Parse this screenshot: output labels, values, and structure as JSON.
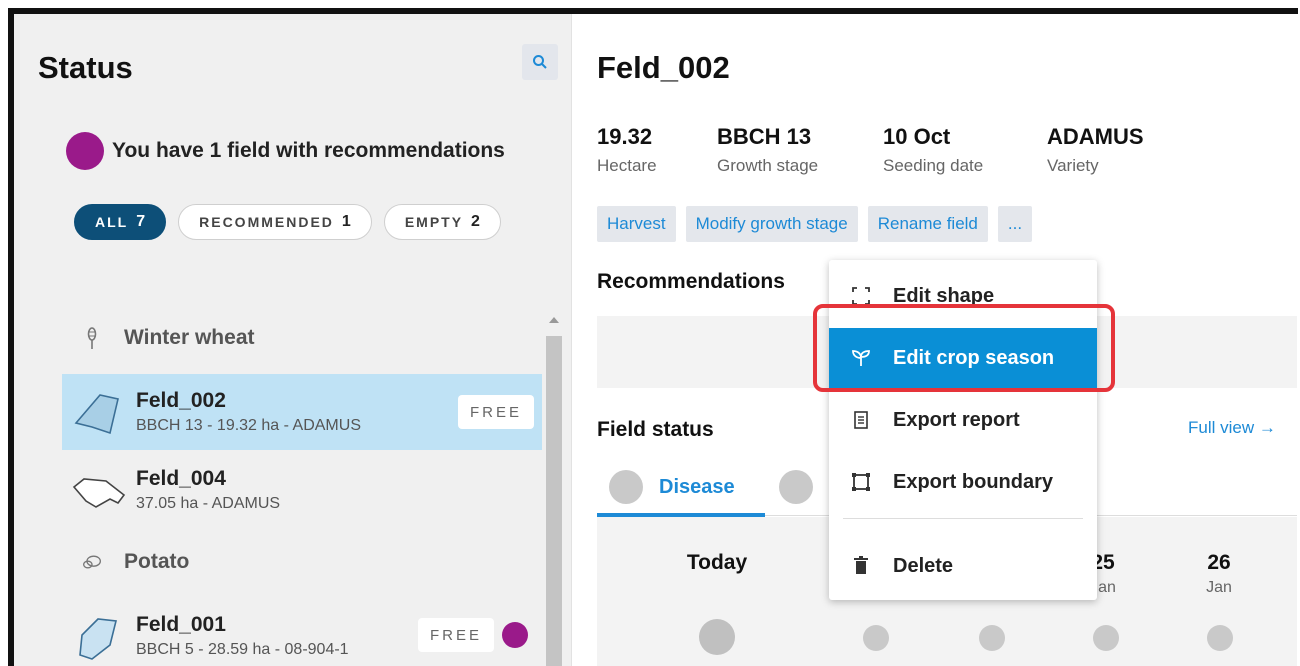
{
  "colors": {
    "accent": "#1d8ad6",
    "active_pill": "#0d4f78",
    "recommendation_dot": "#9a1a8a",
    "selected_row": "#bfe2f5",
    "menu_highlight": "#0a8fd6",
    "annotation_box": "#e5343a"
  },
  "left": {
    "title": "Status",
    "search_icon": "search-icon",
    "banner": "You have 1 field with recommendations",
    "filters": [
      {
        "label": "ALL",
        "count": "7",
        "active": true
      },
      {
        "label": "RECOMMENDED",
        "count": "1",
        "active": false
      },
      {
        "label": "EMPTY",
        "count": "2",
        "active": false
      }
    ],
    "groups": [
      {
        "label": "Winter wheat",
        "icon": "wheat-icon",
        "fields": [
          {
            "name": "Feld_002",
            "meta": "BBCH 13 - 19.32 ha - ADAMUS",
            "badge": "FREE",
            "selected": true
          },
          {
            "name": "Feld_004",
            "meta": "37.05 ha - ADAMUS",
            "badge": "",
            "selected": false
          }
        ]
      },
      {
        "label": "Potato",
        "icon": "potato-icon",
        "fields": [
          {
            "name": "Feld_001",
            "meta": "BBCH 5 - 28.59 ha - 08-904-1",
            "badge": "FREE",
            "selected": false,
            "recommendation": true
          }
        ]
      }
    ]
  },
  "right": {
    "title": "Feld_002",
    "stats": [
      {
        "value": "19.32",
        "label": "Hectare"
      },
      {
        "value": "BBCH 13",
        "label": "Growth stage"
      },
      {
        "value": "10 Oct",
        "label": "Seeding date"
      },
      {
        "value": "ADAMUS",
        "label": "Variety"
      }
    ],
    "actions": [
      "Harvest",
      "Modify growth stage",
      "Rename field",
      "..."
    ],
    "recommendations_title": "Recommendations",
    "field_status_title": "Field status",
    "full_view": "Full view →",
    "tabs": [
      {
        "label": "Disease",
        "active": true
      }
    ],
    "timeline": [
      {
        "num": "Today",
        "mon": ""
      },
      {
        "num": "25",
        "mon": "Jan"
      },
      {
        "num": "26",
        "mon": "Jan"
      }
    ]
  },
  "menu": {
    "items": [
      {
        "label": "Edit shape",
        "icon": "edit-shape-icon"
      },
      {
        "label": "Edit crop season",
        "icon": "sprout-icon",
        "highlight": true
      },
      {
        "label": "Export report",
        "icon": "report-icon"
      },
      {
        "label": "Export boundary",
        "icon": "boundary-icon"
      },
      {
        "label": "Delete",
        "icon": "trash-icon"
      }
    ]
  }
}
